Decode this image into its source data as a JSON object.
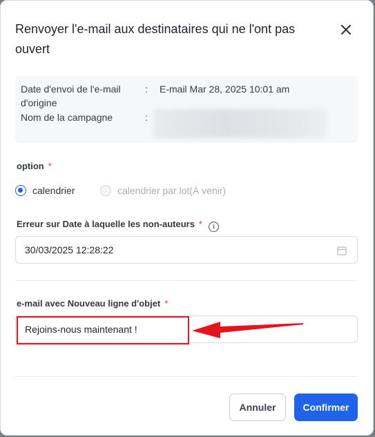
{
  "dialog": {
    "title": "Renvoyer l'e-mail aux destinataires qui ne l'ont pas ouvert",
    "close_icon": "close-icon"
  },
  "info": {
    "date_label": "Date d'envoi de l'e-mail d'origine",
    "date_value": "E-mail Mar 28, 2025 10:01 am",
    "campaign_label": "Nom de la campagne",
    "separator": ":"
  },
  "option": {
    "label": "option",
    "required_mark": "*",
    "choices": [
      {
        "label": "calendrier",
        "selected": true,
        "disabled": false
      },
      {
        "label": "calendrier par lot(À venir)",
        "selected": false,
        "disabled": true
      }
    ]
  },
  "date_field": {
    "label": "Erreur sur Date à laquelle les non-auteurs",
    "required_mark": "*",
    "value": "30/03/2025 12:28:22",
    "icon": "calendar-icon",
    "info_icon": "info-icon"
  },
  "subject_field": {
    "label": "e-mail avec Nouveau ligne d'objet",
    "required_mark": "*",
    "value": "Rejoins-nous maintenant !"
  },
  "annotation": {
    "color": "#e3141c"
  },
  "footer": {
    "cancel_label": "Annuler",
    "confirm_label": "Confirmer"
  },
  "colors": {
    "accent": "#1f63ea",
    "required": "#e5383b"
  }
}
